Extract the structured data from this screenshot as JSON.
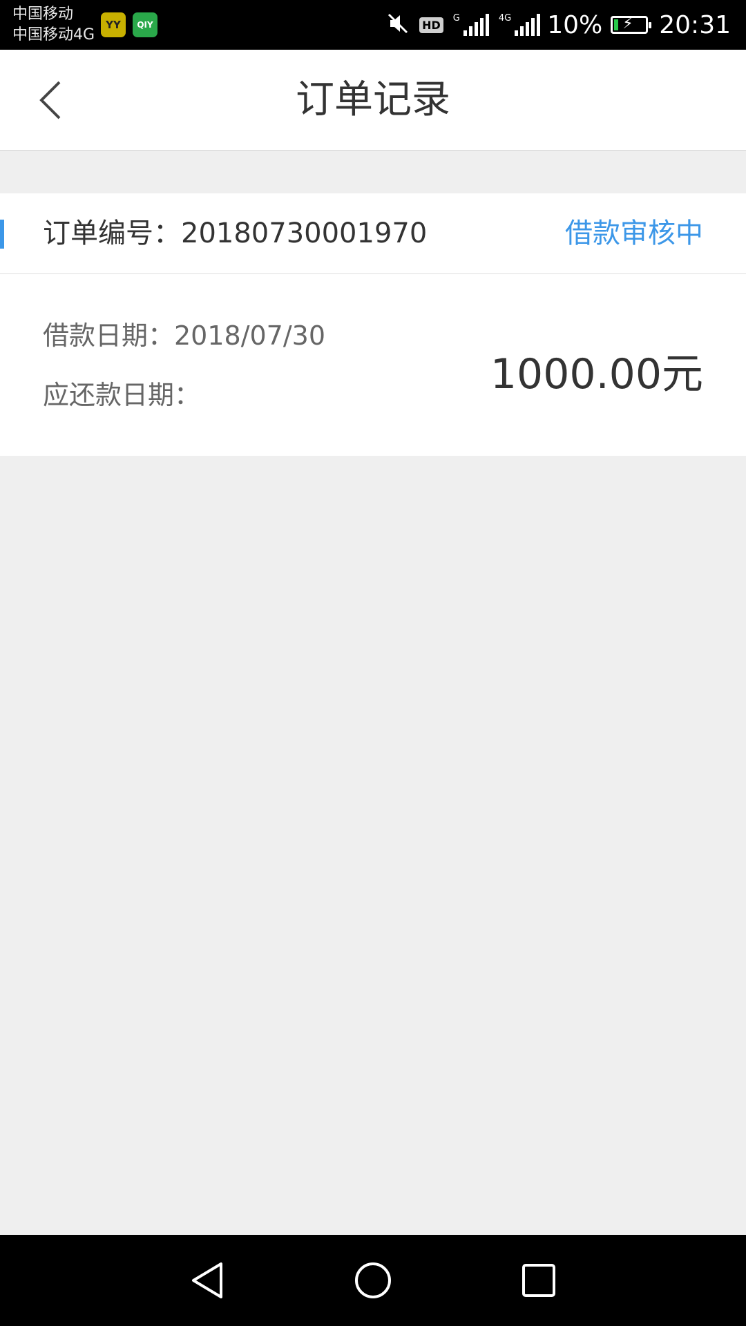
{
  "status_bar": {
    "carrier_1": "中国移动",
    "carrier_2": "中国移动4G",
    "app_badges": [
      "YY",
      "QIY"
    ],
    "hd_label": "HD",
    "net_label_1": "G",
    "net_label_2": "4G",
    "battery": "10%",
    "time": "20:31",
    "icons": [
      "mute-icon",
      "hd-icon",
      "signal-icon",
      "signal-icon",
      "battery-charging-icon"
    ]
  },
  "header": {
    "title": "订单记录",
    "back_icon": "chevron-left-icon"
  },
  "order": {
    "number_label": "订单编号：20180730001970",
    "status": "借款审核中",
    "loan_date": "借款日期：2018/07/30",
    "repay_date": "应还款日期：",
    "amount": "1000.00元"
  },
  "colors": {
    "accent": "#3c97e8",
    "background": "#efefef",
    "card": "#ffffff",
    "text_primary": "#333333",
    "text_secondary": "#666666"
  },
  "system_nav": {
    "icons": [
      "triangle-back-icon",
      "circle-home-icon",
      "square-recent-icon"
    ]
  }
}
